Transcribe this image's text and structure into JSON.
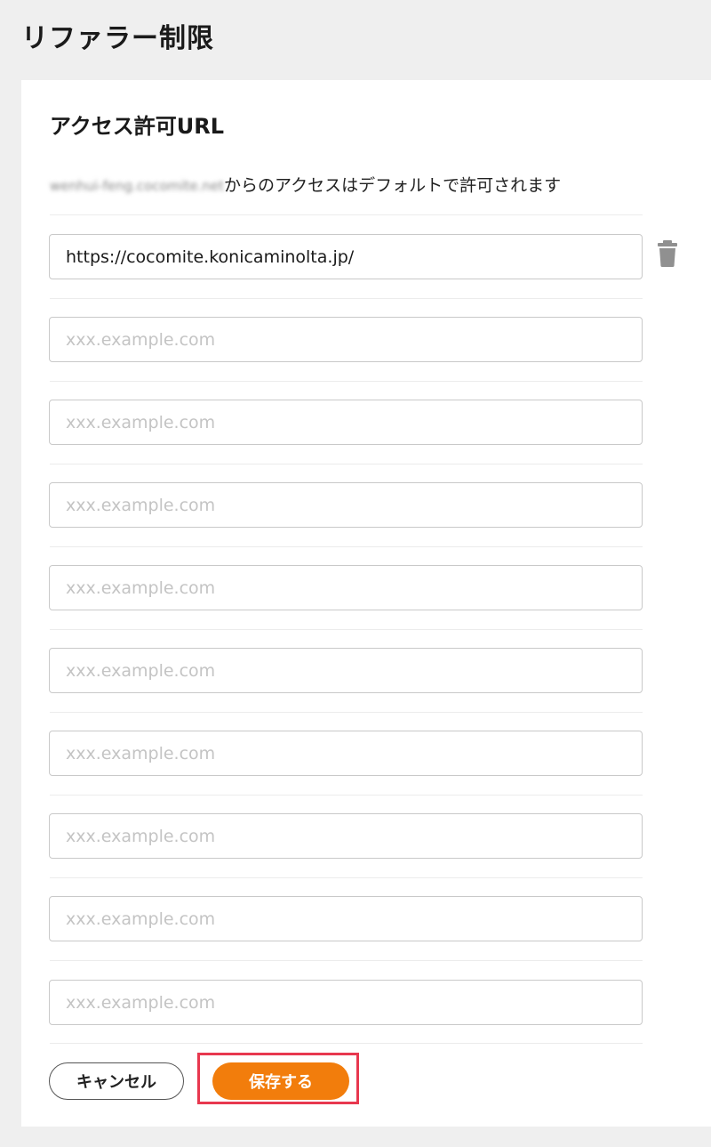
{
  "page": {
    "title": "リファラー制限"
  },
  "section": {
    "title": "アクセス許可URL",
    "default_domain_blurred": "wenhui-feng.cocomite.net",
    "default_note": "からのアクセスはデフォルトで許可されます"
  },
  "inputs": [
    {
      "value": "https://cocomite.konicaminolta.jp/",
      "placeholder": "xxx.example.com"
    },
    {
      "value": "",
      "placeholder": "xxx.example.com"
    },
    {
      "value": "",
      "placeholder": "xxx.example.com"
    },
    {
      "value": "",
      "placeholder": "xxx.example.com"
    },
    {
      "value": "",
      "placeholder": "xxx.example.com"
    },
    {
      "value": "",
      "placeholder": "xxx.example.com"
    },
    {
      "value": "",
      "placeholder": "xxx.example.com"
    },
    {
      "value": "",
      "placeholder": "xxx.example.com"
    },
    {
      "value": "",
      "placeholder": "xxx.example.com"
    },
    {
      "value": "",
      "placeholder": "xxx.example.com"
    }
  ],
  "icons": {
    "delete": "trash-icon"
  },
  "actions": {
    "cancel_label": "キャンセル",
    "save_label": "保存する"
  },
  "colors": {
    "save_button": "#f27d0c",
    "highlight": "#e8384f",
    "background": "#efefef"
  }
}
